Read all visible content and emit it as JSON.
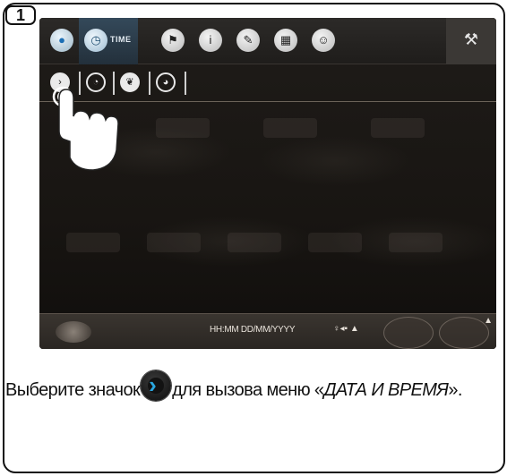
{
  "step": {
    "number": "1"
  },
  "screen": {
    "top_bar": {
      "time_label": "TIME",
      "icons": [
        "water-drop-icon",
        "clock-icon",
        "flag-icon",
        "info-icon",
        "pencil-icon",
        "calendar-icon",
        "person-icon",
        "wrench-icon"
      ]
    },
    "sub_bar": {
      "icons": [
        "clock-settings-icon",
        "timer-icon",
        "leaf-icon",
        "eco-timer-icon"
      ]
    },
    "bottom_bar": {
      "datetime": "HH:MM DD/MM/YYYY",
      "status": "♀◂▪ ▲"
    }
  },
  "instruction": {
    "before": "Выберите значок",
    "after": "для вызова меню «",
    "menu_name": "ДАТА И ВРЕМЯ",
    "end": "»."
  },
  "colors": {
    "accent_blue": "#2aa7e0",
    "screen_bg": "#1a1714",
    "time_tab": "#34495a"
  }
}
